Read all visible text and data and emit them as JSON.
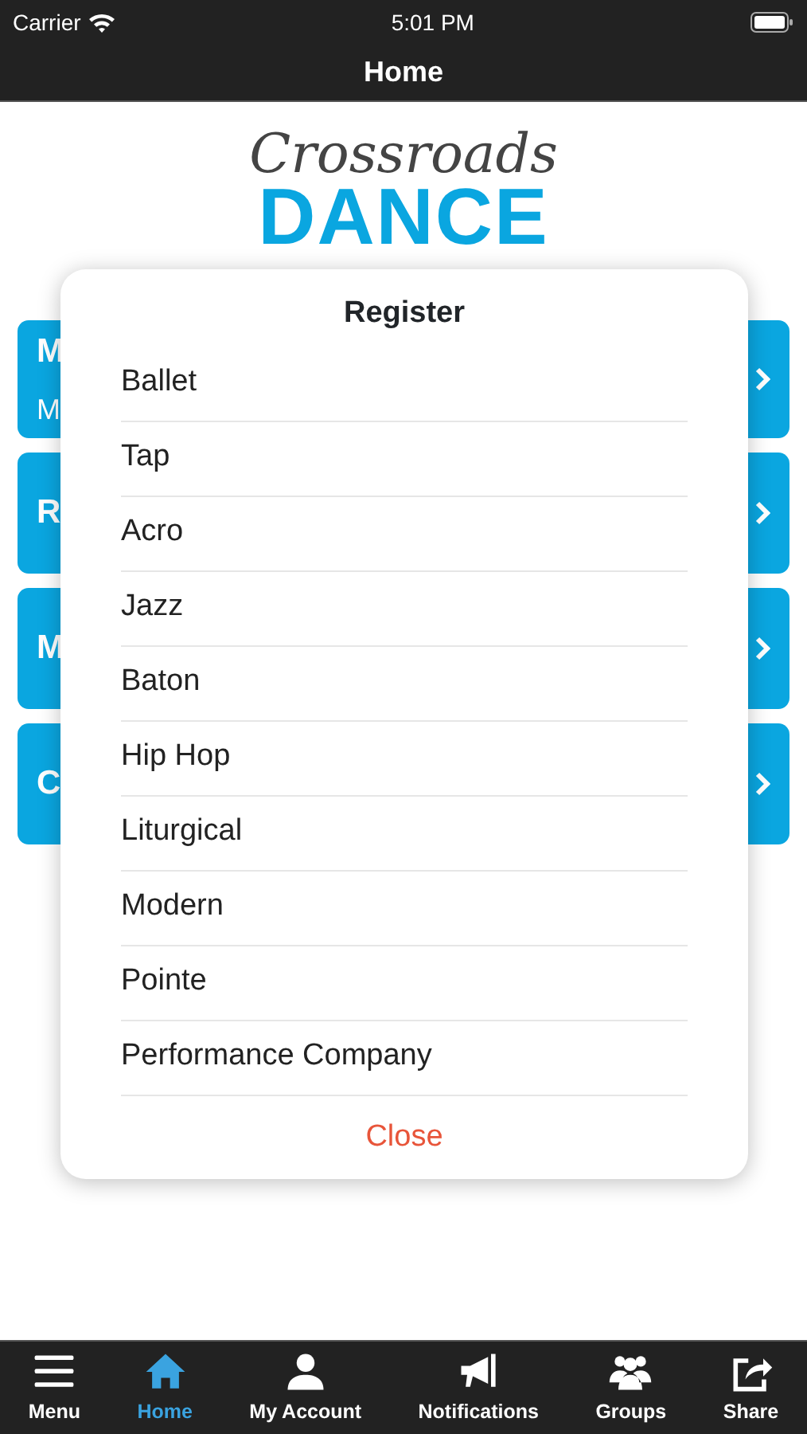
{
  "status_bar": {
    "carrier": "Carrier",
    "time": "5:01 PM"
  },
  "nav_bar": {
    "title": "Home"
  },
  "logo": {
    "script": "Crossroads",
    "word": "DANCE"
  },
  "cards": [
    {
      "title": "M",
      "subtitle": "M"
    },
    {
      "title": "R"
    },
    {
      "title": "M"
    },
    {
      "title": "C"
    }
  ],
  "dialog": {
    "title": "Register",
    "items": [
      "Ballet",
      "Tap",
      "Acro",
      "Jazz",
      "Baton",
      "Hip Hop",
      "Liturgical",
      "Modern",
      "Pointe",
      "Performance Company"
    ],
    "close": "Close"
  },
  "tab_bar": [
    {
      "label": "Menu",
      "kind": "menu",
      "selected": false
    },
    {
      "label": "Home",
      "kind": "home",
      "selected": true
    },
    {
      "label": "My Account",
      "kind": "account",
      "selected": false
    },
    {
      "label": "Notifications",
      "kind": "notifications",
      "selected": false
    },
    {
      "label": "Groups",
      "kind": "groups",
      "selected": false
    },
    {
      "label": "Share",
      "kind": "share",
      "selected": false
    }
  ]
}
